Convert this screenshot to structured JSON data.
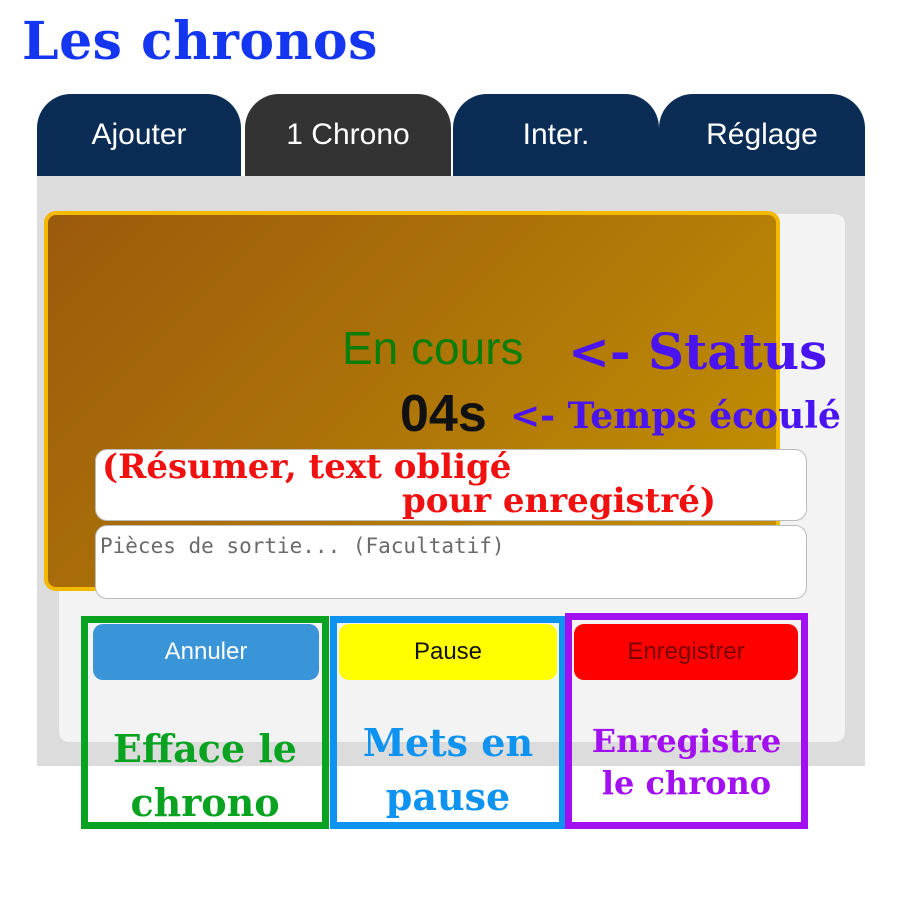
{
  "page": {
    "title": "Les chronos"
  },
  "tabs": [
    {
      "label": "Ajouter",
      "active": false
    },
    {
      "label": "1 Chrono",
      "active": true
    },
    {
      "label": "Inter.",
      "active": false
    },
    {
      "label": "Réglage",
      "active": false
    }
  ],
  "chrono": {
    "status": "En cours",
    "elapsed": "04s",
    "pieces_placeholder": "Pièces de sortie... (Facultatif)"
  },
  "buttons": {
    "cancel": "Annuler",
    "pause": "Pause",
    "save": "Enregistrer"
  },
  "annotations": {
    "status": "<- Status",
    "elapsed": "<- Temps écoulé",
    "summary_line1": "(Résumer, text obligé",
    "summary_line2": "pour enregistré)",
    "cancel_line1": "Efface le",
    "cancel_line2": "chrono",
    "pause_line1": "Mets en",
    "pause_line2": "pause",
    "save_line1": "Enregistre",
    "save_line2": "le chrono"
  },
  "colors": {
    "title": "#1436f0",
    "tab": "#0b2d55",
    "tab_active": "#333333",
    "cancel": "#3a95d8",
    "pause": "#ffff00",
    "save": "#ff0000",
    "note_green": "#09a321",
    "note_blue": "#0f93f0",
    "note_purple": "#a20ff0",
    "note_violet": "#4a14f0",
    "note_red": "#f01010",
    "status_text": "#0a7d0a"
  }
}
